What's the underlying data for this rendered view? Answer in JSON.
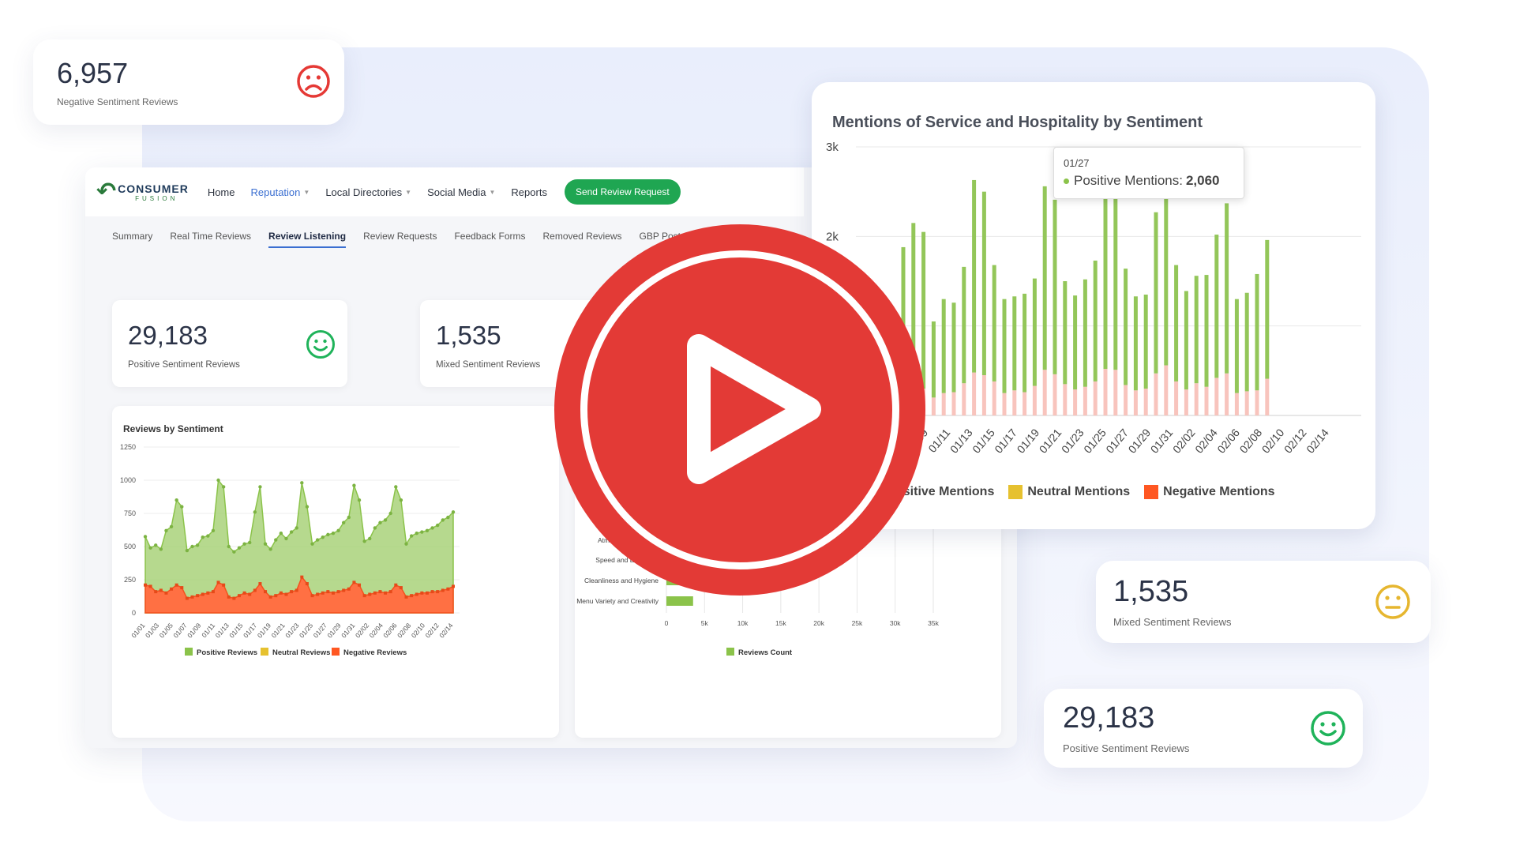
{
  "colors": {
    "positive": "#8bc34a",
    "neutral": "#e6c12f",
    "negative": "#ff5722",
    "negative_soft": "#f8c4bd",
    "accent": "#3b6fd1",
    "brand_green": "#1fa652",
    "play_red": "#e33a36"
  },
  "logo": {
    "line1": "CONSUMER",
    "line2": "FUSION"
  },
  "nav": {
    "items": [
      "Home",
      "Reputation",
      "Local Directories",
      "Social Media",
      "Reports"
    ],
    "active": "Reputation",
    "cta": "Send Review Request"
  },
  "subtabs": [
    "Summary",
    "Real Time Reviews",
    "Review Listening",
    "Review Requests",
    "Feedback Forms",
    "Removed Reviews",
    "GBP Posts"
  ],
  "stats": {
    "negative": {
      "value": "6,957",
      "label": "Negative Sentiment Reviews",
      "icon": "sad-face-icon"
    },
    "positive": {
      "value": "29,183",
      "label": "Positive Sentiment Reviews",
      "icon": "smile-face-icon"
    },
    "mixed": {
      "value": "1,535",
      "label": "Mixed Sentiment Reviews",
      "icon": "neutral-face-icon"
    }
  },
  "chart_data": [
    {
      "type": "area",
      "title": "Reviews by Sentiment",
      "ylim": [
        0,
        1250
      ],
      "yticks": [
        "1250",
        "1000",
        "750",
        "500",
        "250",
        "0"
      ],
      "xticks": [
        "01/01",
        "01/03",
        "01/05",
        "01/07",
        "01/09",
        "01/11",
        "01/13",
        "01/15",
        "01/17",
        "01/19",
        "01/21",
        "01/23",
        "01/25",
        "01/27",
        "01/29",
        "01/31",
        "02/02",
        "02/04",
        "02/06",
        "02/08",
        "02/10",
        "02/12",
        "02/14"
      ],
      "series": [
        {
          "name": "Positive Reviews",
          "values": [
            575,
            490,
            510,
            480,
            620,
            650,
            850,
            800,
            470,
            500,
            510,
            570,
            580,
            620,
            1000,
            950,
            500,
            460,
            490,
            520,
            530,
            760,
            950,
            520,
            480,
            550,
            600,
            560,
            610,
            640,
            980,
            800,
            520,
            550,
            570,
            590,
            600,
            620,
            680,
            720,
            960,
            850,
            540,
            560,
            640,
            680,
            700,
            750,
            950,
            850,
            520,
            580,
            600,
            610,
            620,
            640,
            660,
            700,
            720,
            760
          ]
        },
        {
          "name": "Neutral Reviews",
          "values": [
            15,
            10,
            12,
            10,
            15,
            12,
            20,
            18,
            10,
            12,
            12,
            14,
            12,
            12,
            20,
            18,
            10,
            10,
            12,
            12,
            12,
            15,
            18,
            12,
            10,
            12,
            12,
            12,
            12,
            12,
            20,
            15,
            12,
            12,
            12,
            12,
            12,
            12,
            14,
            14,
            20,
            18,
            12,
            12,
            12,
            14,
            14,
            14,
            18,
            16,
            12,
            12,
            12,
            12,
            12,
            12,
            12,
            14,
            14,
            14
          ]
        },
        {
          "name": "Negative Reviews",
          "values": [
            210,
            200,
            160,
            170,
            150,
            180,
            210,
            190,
            110,
            120,
            130,
            140,
            150,
            160,
            230,
            210,
            120,
            110,
            130,
            150,
            140,
            170,
            220,
            160,
            120,
            130,
            150,
            140,
            160,
            170,
            270,
            220,
            130,
            140,
            150,
            160,
            150,
            160,
            170,
            180,
            230,
            210,
            130,
            140,
            150,
            160,
            150,
            160,
            210,
            190,
            120,
            130,
            140,
            150,
            150,
            160,
            160,
            170,
            180,
            200
          ]
        }
      ],
      "legend": "bottom"
    },
    {
      "type": "bar",
      "orientation": "horizontal",
      "categories": [
        "Atmosphere and Ambience",
        "Speed and Efficiency",
        "Cleanliness and Hygiene",
        "Menu Variety and Creativity"
      ],
      "visible_categories": [
        "Atmosphere and Am",
        "Speed and Efficiency",
        "Cleanliness and Hygiene",
        "Menu Variety and Creativity"
      ],
      "values": [
        6000,
        5300,
        4200,
        3500
      ],
      "xlim": [
        0,
        35000
      ],
      "xticks": [
        "0",
        "5k",
        "10k",
        "15k",
        "20k",
        "25k",
        "30k",
        "35k"
      ],
      "series_name": "Reviews Count"
    },
    {
      "type": "bar",
      "stacked": true,
      "title": "Mentions of Service and Hospitality by Sentiment",
      "ylim": [
        0,
        3000
      ],
      "yticks": [
        "3k",
        "2k"
      ],
      "xticks": [
        "01/09",
        "01/11",
        "01/13",
        "01/15",
        "01/17",
        "01/19",
        "01/21",
        "01/23",
        "01/25",
        "01/27",
        "01/29",
        "01/31",
        "02/02",
        "02/04",
        "02/06",
        "02/08",
        "02/10",
        "02/12",
        "02/14"
      ],
      "series": [
        {
          "name": "Positive Mentions",
          "values": [
            1450,
            1800,
            1750,
            850,
            1050,
            1000,
            1300,
            2150,
            2050,
            1300,
            1050,
            1050,
            1100,
            1200,
            2050,
            1950,
            1150,
            1050,
            1200,
            1350,
            2060,
            2050,
            1300,
            1050,
            1050,
            1800,
            2120,
            1300,
            1100,
            1200,
            1250,
            1600,
            1900,
            1050,
            1100,
            1300,
            1550
          ]
        },
        {
          "name": "Neutral Mentions",
          "values": [
            0,
            0,
            0,
            0,
            0,
            0,
            0,
            0,
            0,
            0,
            0,
            0,
            0,
            0,
            0,
            0,
            0,
            0,
            0,
            0,
            0,
            0,
            0,
            0,
            0,
            0,
            0,
            0,
            0,
            0,
            0,
            0,
            0,
            0,
            0,
            0,
            0
          ]
        },
        {
          "name": "Negative Mentions",
          "values": [
            430,
            350,
            300,
            200,
            250,
            260,
            360,
            480,
            450,
            380,
            250,
            280,
            260,
            330,
            510,
            460,
            350,
            290,
            320,
            380,
            520,
            510,
            340,
            280,
            300,
            470,
            560,
            380,
            290,
            360,
            320,
            420,
            470,
            250,
            270,
            280,
            410
          ]
        }
      ],
      "tooltip": {
        "date": "01/27",
        "label": "Positive Mentions:",
        "value": "2,060"
      },
      "legend": {
        "visible_first": "ositive Mentions",
        "neutral": "Neutral Mentions",
        "negative": "Negative Mentions"
      }
    }
  ]
}
